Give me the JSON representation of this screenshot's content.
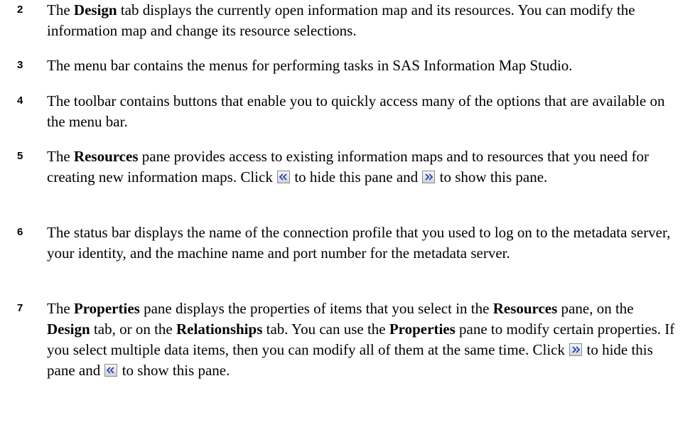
{
  "items": [
    {
      "number": "2",
      "parts": {
        "t1": "The ",
        "b1": "Design",
        "t2": " tab displays the currently open information map and its resources. You can modify the information map and change its resource selections."
      }
    },
    {
      "number": "3",
      "parts": {
        "t1": "The menu bar contains the menus for performing tasks in SAS Information Map Studio."
      }
    },
    {
      "number": "4",
      "parts": {
        "t1": "The toolbar contains buttons that enable you to quickly access many of the options that are available on the menu bar."
      }
    },
    {
      "number": "5",
      "parts": {
        "t1": "The ",
        "b1": "Resources",
        "t2": " pane provides access to existing information maps and to resources that you need for creating new information maps. Click ",
        "t3": " to hide this pane and ",
        "t4": " to show this pane."
      }
    },
    {
      "number": "6",
      "parts": {
        "t1": "The status bar displays the name of the connection profile that you used to log on to the metadata server, your identity, and the machine name and port number for the metadata server."
      }
    },
    {
      "number": "7",
      "parts": {
        "t1": "The ",
        "b1": "Properties",
        "t2": " pane displays the properties of items that you select in the ",
        "b2": "Resources",
        "t3": " pane, on the ",
        "b3": "Design",
        "t4": " tab, or on the ",
        "b4": "Relationships",
        "t5": " tab. You can use the ",
        "b5": "Properties",
        "t6": " pane to modify certain properties. If you select multiple data items, then you can modify all of them at the same time. Click ",
        "t7": " to hide this pane and ",
        "t8": " to show this pane."
      }
    }
  ],
  "icons": {
    "hide_left": "double-chevron-left-icon",
    "show_right": "double-chevron-right-icon",
    "icon_color": "#1f3fbf"
  }
}
